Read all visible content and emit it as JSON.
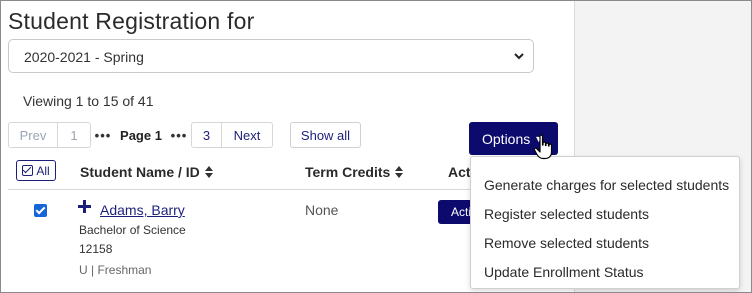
{
  "page": {
    "title": "Student Registration for",
    "term_select": {
      "value": "2020-2021 - Spring"
    },
    "viewing": "Viewing 1 to 15 of 41"
  },
  "pagination": {
    "prev": "Prev",
    "first": "1",
    "ellipsis": "•••",
    "current": "Page 1",
    "last": "3",
    "next": "Next",
    "show_all": "Show all"
  },
  "toolbar": {
    "options_label": "Options",
    "options_caret": "▼"
  },
  "table": {
    "select_all_label": "All",
    "columns": {
      "name": "Student Name / ID",
      "credits": "Term Credits",
      "actions": "Actions"
    },
    "rows": [
      {
        "name": "Adams, Barry",
        "program": "Bachelor of Science",
        "id": "12158",
        "level": "U | Freshman",
        "credits": "None",
        "action": "Actions",
        "checked": true
      }
    ]
  },
  "options_menu": {
    "items": [
      "Generate charges for selected students",
      "Register selected students",
      "Remove selected students",
      "Update Enrollment Status"
    ]
  },
  "colors": {
    "primary": "#0d0a6e",
    "link": "#1b1f7a",
    "checkbox": "#1565d8"
  },
  "icons": {
    "select_chevron": "chevron-down-icon",
    "sort": "sort-icon",
    "expand": "plus-icon",
    "cursor": "hand-pointer-icon",
    "check": "checkbox-icon"
  }
}
